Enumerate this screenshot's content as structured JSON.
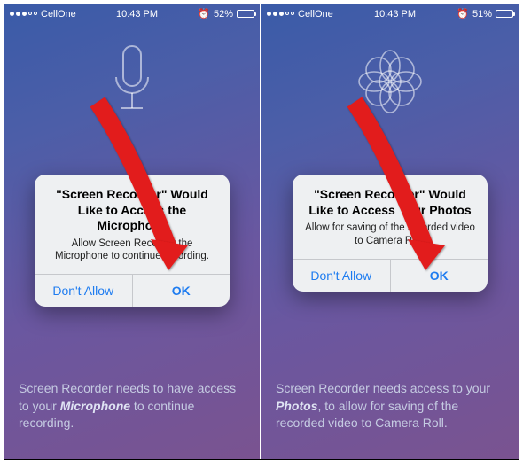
{
  "left": {
    "status": {
      "carrier": "CellOne",
      "time": "10:43 PM",
      "battery": "52%"
    },
    "icon": "microphone-icon",
    "alert": {
      "title": "\"Screen Recorder\" Would Like to Access the Microphone",
      "message": "Allow Screen Recorder the Microphone to continue recording.",
      "deny": "Don't Allow",
      "ok": "OK"
    },
    "caption_pre": "Screen Recorder needs to have access to your ",
    "caption_em": "Microphone",
    "caption_post": " to continue recording."
  },
  "right": {
    "status": {
      "carrier": "CellOne",
      "time": "10:43 PM",
      "battery": "51%"
    },
    "icon": "flower-icon",
    "alert": {
      "title": "\"Screen Recorder\" Would Like to Access Your Photos",
      "message": "Allow for saving of the recorded video to Camera Roll.",
      "deny": "Don't Allow",
      "ok": "OK"
    },
    "caption_pre": "Screen Recorder needs access to your ",
    "caption_em": "Photos",
    "caption_post": ", to allow for saving of the recorded video to Camera Roll."
  }
}
